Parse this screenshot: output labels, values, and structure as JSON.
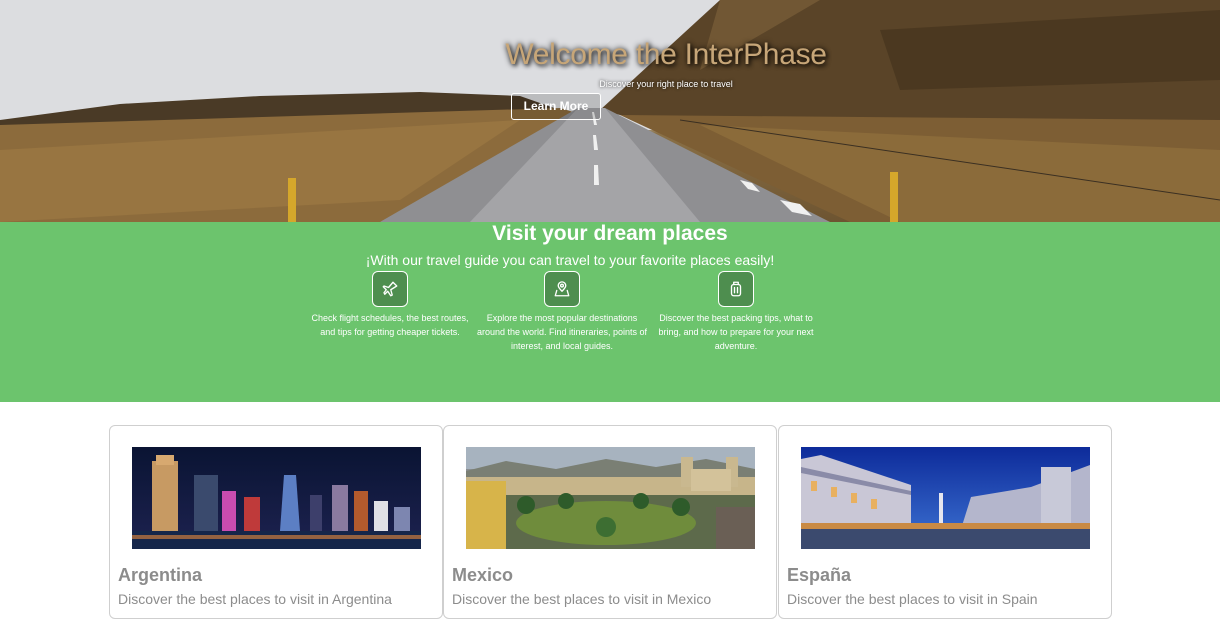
{
  "hero": {
    "title": "Welcome the InterPhase",
    "subtitle": "Discover your right place to travel",
    "button_label": "Learn More"
  },
  "intro": {
    "title": "Visit your dream places",
    "subtitle": "¡With our travel guide you can travel to your favorite places easily!",
    "background": "#6cc46d",
    "features": [
      {
        "icon": "airplane-icon",
        "text": "Check flight schedules, the best routes, and tips for getting cheaper tickets."
      },
      {
        "icon": "map-pin-icon",
        "text": "Explore the most popular destinations around the world. Find itineraries, points of interest, and local guides."
      },
      {
        "icon": "luggage-icon",
        "text": "Discover the best packing tips, what to bring, and how to prepare for your next adventure."
      }
    ]
  },
  "destinations": [
    {
      "name": "Argentina",
      "description": "Discover the best places to visit in Argentina"
    },
    {
      "name": "Mexico",
      "description": "Discover the best places to visit in Mexico"
    },
    {
      "name": "España",
      "description": "Discover the best places to visit in Spain"
    }
  ]
}
